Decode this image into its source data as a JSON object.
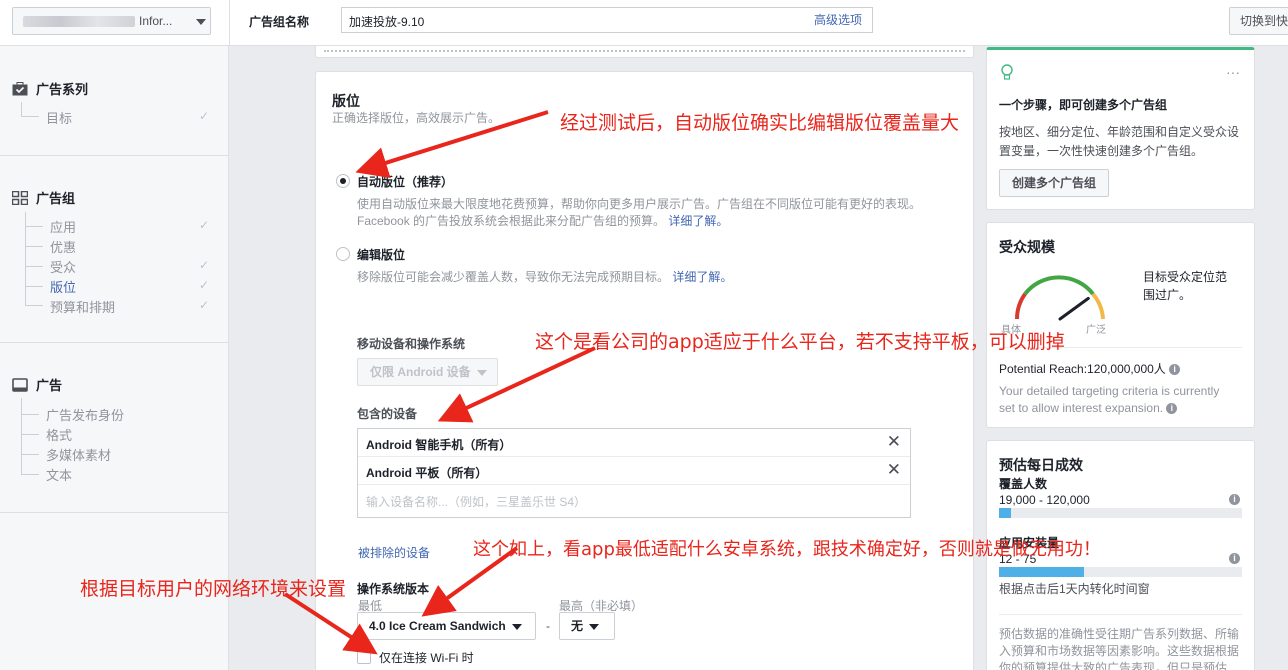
{
  "topbar": {
    "account_name": "Infor...",
    "adset_name_label": "广告组名称",
    "adset_name_value": "加速投放-9.10",
    "advanced_options": "高级选项",
    "switch_label": "切换到快"
  },
  "sidebar": {
    "campaign": {
      "title": "广告系列",
      "items": [
        {
          "label": "目标"
        }
      ]
    },
    "adset": {
      "title": "广告组",
      "items": [
        {
          "label": "应用"
        },
        {
          "label": "优惠"
        },
        {
          "label": "受众"
        },
        {
          "label": "版位"
        },
        {
          "label": "预算和排期"
        }
      ]
    },
    "ad": {
      "title": "广告",
      "items": [
        {
          "label": "广告发布身份"
        },
        {
          "label": "格式"
        },
        {
          "label": "多媒体素材"
        },
        {
          "label": "文本"
        }
      ]
    }
  },
  "placements": {
    "title": "版位",
    "subtitle": "正确选择版位，高效展示广告。",
    "auto": {
      "label": "自动版位（推荐）",
      "desc_line1": "使用自动版位来最大限度地花费预算，帮助你向更多用户展示广告。广告组在不同版位可能有更好的表现。",
      "desc_line2": "Facebook 的广告投放系统会根据此来分配广告组的预算。",
      "learn_more": "详细了解。"
    },
    "edit": {
      "label": "编辑版位",
      "desc": "移除版位可能会减少覆盖人数，导致你无法完成预期目标。",
      "learn_more": "详细了解。"
    },
    "mobile_os_label": "移动设备和操作系统",
    "mobile_os_value": "仅限 Android 设备",
    "included_devices_label": "包含的设备",
    "devices": [
      {
        "label": "Android 智能手机（所有）"
      },
      {
        "label": "Android 平板（所有）"
      }
    ],
    "device_placeholder": "输入设备名称...（例如，三星盖乐世 S4）",
    "excluded_devices_link": "被排除的设备",
    "os_version_label": "操作系统版本",
    "min_label": "最低",
    "max_label": "最高（非必填）",
    "min_value": "4.0 Ice Cream Sandwich",
    "dash": "-",
    "max_value": "无",
    "wifi_only": "仅在连接 Wi-Fi 时"
  },
  "tip_card": {
    "title": "一个步骤，即可创建多个广告组",
    "text_line1": "按地区、细分定位、年龄范围和自定义受众设",
    "text_line2": "置变量，一次性快速创建多个广告组。",
    "button": "创建多个广告组",
    "more": "···"
  },
  "audience": {
    "title": "受众规模",
    "gauge_left": "具体",
    "gauge_right": "广泛",
    "summary_line1": "目标受众定位范",
    "summary_line2": "围过广。",
    "potential_reach": "Potential Reach:120,000,000人",
    "note_line1": "Your detailed targeting criteria is currently",
    "note_line2": "set to allow interest expansion.",
    "gauge_level": 0.8
  },
  "estimate": {
    "title": "预估每日成效",
    "reach_label": "覆盖人数",
    "reach_value": "19,000 - 120,000",
    "reach_level": 0.05,
    "installs_label": "应用安装量",
    "installs_value": "12 - 75",
    "installs_level": 0.35,
    "window_note": "根据点击后1天内转化时间窗",
    "disclaimer_line1": "预估数据的准确性受往期广告系列数据、所输",
    "disclaimer_line2": "入预算和市场数据等因素影响。这些数据根据",
    "disclaimer_line3": "你的预算提供大致的广告表现，但只是预估"
  },
  "annotations": {
    "a1": "经过测试后，自动版位确实比编辑版位覆盖量大",
    "a2": "这个是看公司的app适应于什么平台，若不支持平板，可以删掉",
    "a3": "这个如上，看app最低适配什么安卓系统，跟技术确定好，否则就是做无用功！",
    "a4": "根据目标用户的网络环境来设置"
  },
  "colors": {
    "accent": "#4267b2",
    "annotation": "#e8261c",
    "bar_fill": "#4fb0e8",
    "tip_top": "#42b883"
  }
}
